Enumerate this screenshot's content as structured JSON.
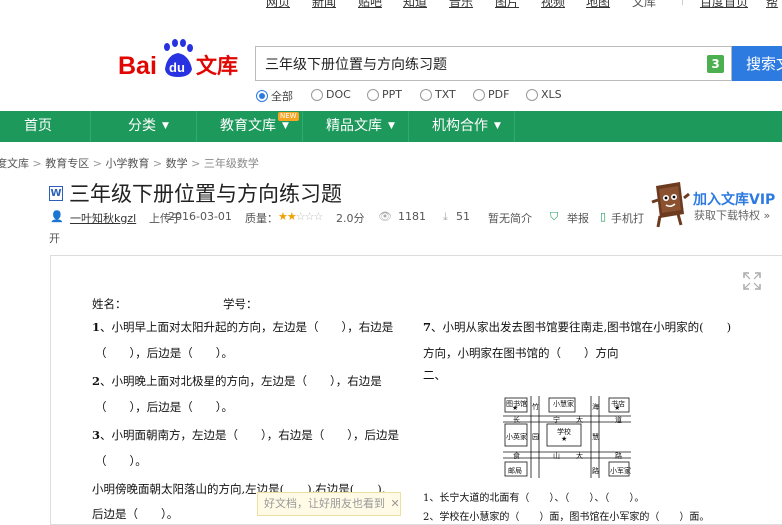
{
  "topnav": {
    "items": [
      "网页",
      "新闻",
      "贴吧",
      "知道",
      "音乐",
      "图片",
      "视频",
      "地图",
      "文库"
    ],
    "home": "百度首页",
    "extra": "帮"
  },
  "search": {
    "query": "三年级下册位置与方向练习题",
    "badge": "3",
    "button": "搜索文"
  },
  "filters": [
    "全部",
    "DOC",
    "PPT",
    "TXT",
    "PDF",
    "XLS"
  ],
  "nav": {
    "home": "首页",
    "category": "分类",
    "edu": "教育文库",
    "new_badge": "NEW",
    "premium": "精品文库",
    "org": "机构合作"
  },
  "breadcrumb": [
    "度文库",
    "教育专区",
    "小学教育",
    "数学",
    "三年级数学"
  ],
  "document": {
    "type_icon": "W",
    "title": "三年级下册位置与方向练习题",
    "uploader": "一叶知秋kgzl",
    "upload_text": "上传于",
    "date": "2016-03-01",
    "quality_label": "质量：",
    "rating": "2.0分",
    "views": "1181",
    "downloads": "51",
    "summary": "暂无简介",
    "report": "举报",
    "mobile": "手机打",
    "mobile_tail": "开"
  },
  "vip": {
    "title": "加入文库VIP",
    "subtitle": "获取下载特权"
  },
  "content": {
    "line_name": "姓名：",
    "line_no": "学号：",
    "q1_num": "1",
    "q1a": "、小明早上面对太阳升起的方向，左边是（　　），右边是",
    "q1b": "（　　），后边是（　　）。",
    "q2_num": "2",
    "q2a": "、小明晚上面对北极星的方向，左边是（　　），右边是",
    "q2b": "（　　），后边是（　　）。",
    "q3_num": "3",
    "q3a": "、小明面朝南方，左边是（　　），右边是（　　），后边是",
    "q3b": "（　　）。",
    "q4a": "小明傍晚面朝太阳落山的方向,左边是(　　),右边是(　　),",
    "q4b": "后边是（　　）。",
    "q7_num": "7",
    "q7a": "、小明从家出发去图书馆要往南走,图书馆在小明家的(　　)",
    "q7b": "方向，小明家在图书馆的（　　）方向",
    "sec2": "二、",
    "map": {
      "library": "图书馆",
      "bamboo": "竹",
      "xiaohui": "小慧家",
      "sea": "海",
      "bookstore": "书店",
      "chang": "长",
      "ning": "宁",
      "da": "大",
      "dao": "道",
      "xiaoying": "小英家",
      "yuan": "园",
      "school": "学校",
      "hui": "慧",
      "shi": "食",
      "shan": "山",
      "lu": "路",
      "post": "邮局",
      "xiaojun": "小军家"
    },
    "s1": "1、长宁大道的北面有（　　）、（　　）、（　　）。",
    "s2": "2、学校在小慧家的（　　）面，图书馆在小军家的（　　）面。"
  },
  "toast": "好文档，让好朋友也看到"
}
